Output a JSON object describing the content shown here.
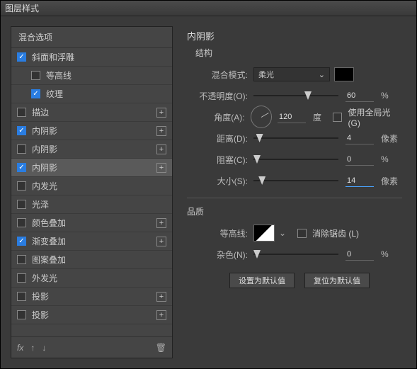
{
  "window": {
    "title": "图层样式"
  },
  "sidebar": {
    "header": "混合选项",
    "items": [
      {
        "label": "斜面和浮雕",
        "checked": true,
        "plus": false,
        "child": false
      },
      {
        "label": "等高线",
        "checked": false,
        "plus": false,
        "child": true
      },
      {
        "label": "纹理",
        "checked": true,
        "plus": false,
        "child": true
      },
      {
        "label": "描边",
        "checked": false,
        "plus": true,
        "child": false
      },
      {
        "label": "内阴影",
        "checked": true,
        "plus": true,
        "child": false
      },
      {
        "label": "内阴影",
        "checked": false,
        "plus": true,
        "child": false
      },
      {
        "label": "内阴影",
        "checked": true,
        "plus": true,
        "child": false,
        "active": true
      },
      {
        "label": "内发光",
        "checked": false,
        "plus": false,
        "child": false
      },
      {
        "label": "光泽",
        "checked": false,
        "plus": false,
        "child": false
      },
      {
        "label": "颜色叠加",
        "checked": false,
        "plus": true,
        "child": false
      },
      {
        "label": "渐变叠加",
        "checked": true,
        "plus": true,
        "child": false
      },
      {
        "label": "图案叠加",
        "checked": false,
        "plus": false,
        "child": false
      },
      {
        "label": "外发光",
        "checked": false,
        "plus": false,
        "child": false
      },
      {
        "label": "投影",
        "checked": false,
        "plus": true,
        "child": false
      },
      {
        "label": "投影",
        "checked": false,
        "plus": true,
        "child": false
      }
    ],
    "footer": {
      "fx": "fx",
      "up": "↑",
      "down": "↓",
      "trash": "🗑"
    }
  },
  "panel": {
    "title": "内阴影",
    "structure_label": "结构",
    "blend_mode_label": "混合模式:",
    "blend_mode_value": "柔光",
    "opacity_label": "不透明度(O):",
    "opacity_value": "60",
    "angle_label": "角度(A):",
    "angle_value": "120",
    "angle_unit": "度",
    "global_light_label": "使用全局光 (G)",
    "distance_label": "距离(D):",
    "distance_value": "4",
    "choke_label": "阻塞(C):",
    "choke_value": "0",
    "size_label": "大小(S):",
    "size_value": "14",
    "px_unit": "像素",
    "pct_unit": "%",
    "quality_label": "品质",
    "contour_label": "等高线:",
    "antialias_label": "消除锯齿 (L)",
    "noise_label": "杂色(N):",
    "noise_value": "0",
    "btn_default": "设置为默认值",
    "btn_reset": "复位为默认值"
  }
}
